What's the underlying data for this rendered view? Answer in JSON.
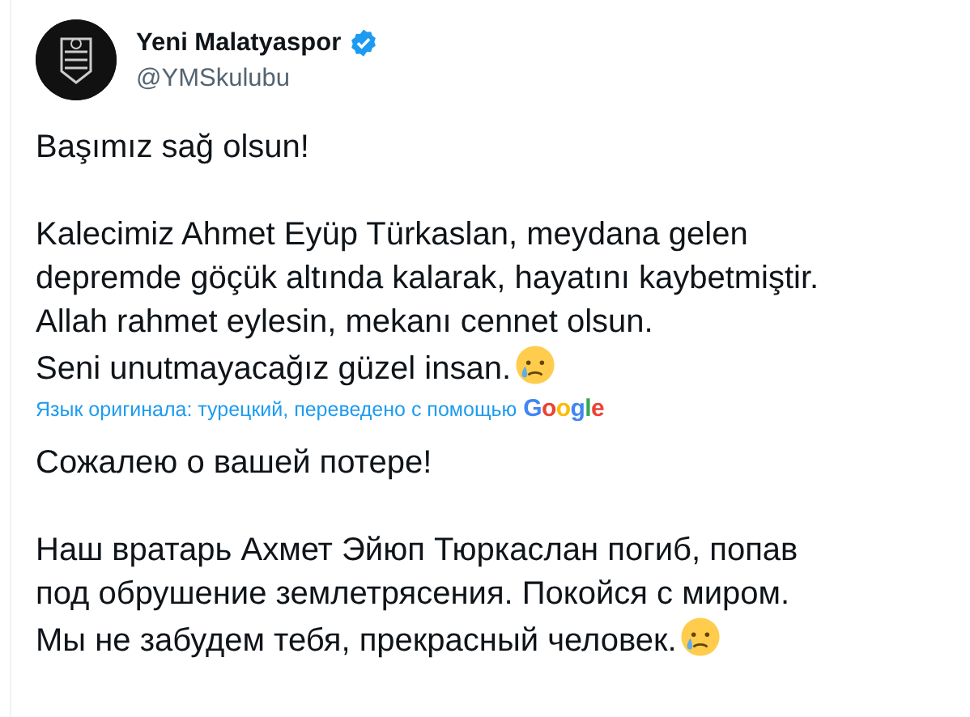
{
  "author": {
    "name": "Yeni Malatyaspor",
    "verified": true,
    "handle": "@YMSkulubu"
  },
  "original": [
    [
      "Başımız sağ olsun!"
    ],
    [
      "Kalecimiz Ahmet Eyüp Türkaslan, meydana gelen depremde göçük altında kalarak, hayatını kaybetmiştir. Allah rahmet eylesin, mekanı cennet olsun.",
      "Seni unutmayacağız güzel insan."
    ]
  ],
  "translation_note": {
    "text": "Язык оригинала: турецкий, переведено с помощью",
    "provider": "Google"
  },
  "translation": [
    [
      "Сожалею о вашей потере!"
    ],
    [
      "Наш вратарь Ахмет Эйюп Тюркаслан погиб, попав под обрушение землетрясения. Покойся с миром.",
      "Мы не забудем тебя, прекрасный человек."
    ]
  ]
}
